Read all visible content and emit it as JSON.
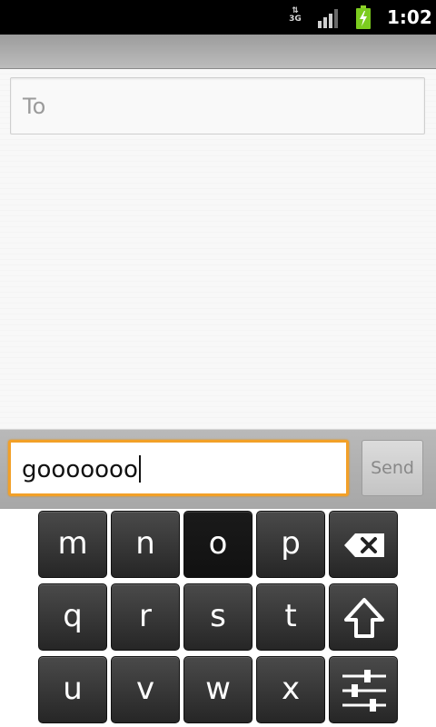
{
  "status_bar": {
    "network": "3G",
    "time": "1:02"
  },
  "to_field": {
    "placeholder": "To"
  },
  "compose": {
    "message_text": "gooooooo",
    "send_label": "Send"
  },
  "keyboard": {
    "row1": [
      "m",
      "n",
      "o",
      "p"
    ],
    "row2": [
      "q",
      "r",
      "s",
      "t"
    ],
    "row3": [
      "u",
      "v",
      "w",
      "x"
    ],
    "pressed_key": "o",
    "icons": [
      "backspace-icon",
      "shift-arrow-icon",
      "settings-sliders-icon"
    ]
  }
}
